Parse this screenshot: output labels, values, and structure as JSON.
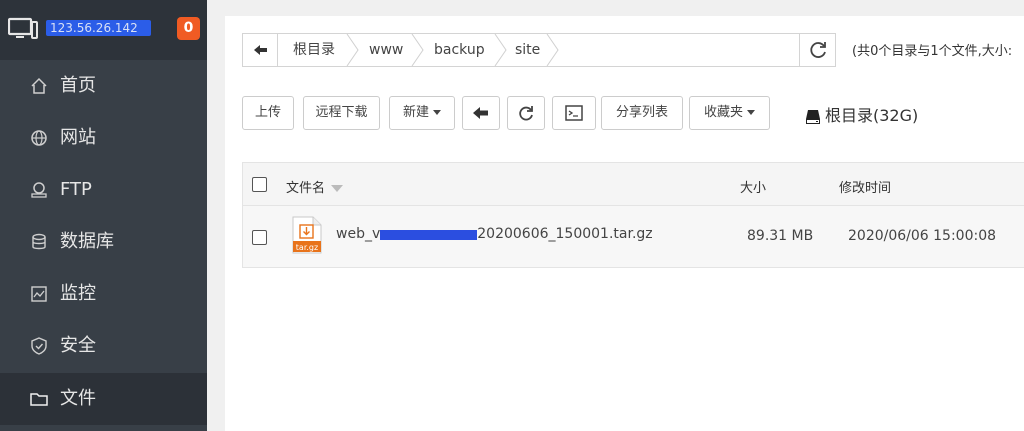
{
  "sidebar": {
    "server_ip": "123.56.26.142",
    "badge": "0",
    "items": [
      {
        "label": "首页",
        "icon": "home-icon",
        "active": false
      },
      {
        "label": "网站",
        "icon": "globe-icon",
        "active": false
      },
      {
        "label": "FTP",
        "icon": "ftp-icon",
        "active": false
      },
      {
        "label": "数据库",
        "icon": "database-icon",
        "active": false
      },
      {
        "label": "监控",
        "icon": "monitor-chart-icon",
        "active": false
      },
      {
        "label": "安全",
        "icon": "shield-icon",
        "active": false
      },
      {
        "label": "文件",
        "icon": "folder-icon",
        "active": true
      }
    ]
  },
  "breadcrumb": {
    "items": [
      "根目录",
      "www",
      "backup",
      "site"
    ],
    "summary": "(共0个目录与1个文件,大小:"
  },
  "toolbar": {
    "upload": "上传",
    "remote_download": "远程下载",
    "new": "新建",
    "share_list": "分享列表",
    "favorites": "收藏夹",
    "disk": "根目录(32G)"
  },
  "table": {
    "headers": {
      "name": "文件名",
      "size": "大小",
      "mtime": "修改时间"
    },
    "rows": [
      {
        "icon_label": "tar.gz",
        "name_prefix": "web_v",
        "name_suffix": "20200606_150001.tar.gz",
        "size": "89.31 MB",
        "mtime": "2020/06/06 15:00:08"
      }
    ]
  }
}
